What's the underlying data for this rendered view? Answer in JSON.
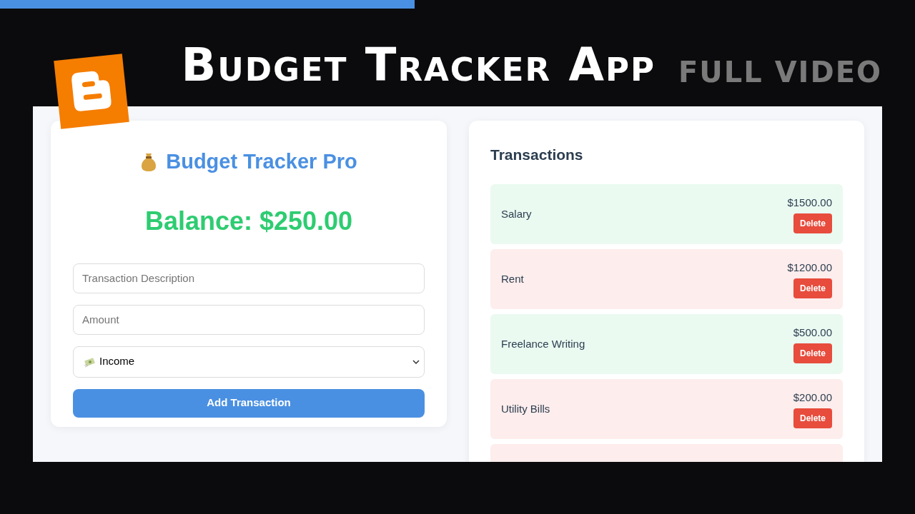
{
  "video_progress": {
    "level": 0.453
  },
  "headline": {
    "title": "Budget Tracker App",
    "tag": "FULL VIDEO"
  },
  "app": {
    "title": "Budget Tracker Pro",
    "balance": "Balance: $250.00",
    "form": {
      "description": {
        "placeholder": "Transaction Description"
      },
      "amount": {
        "placeholder": "Amount"
      },
      "type_select": {
        "value": "Income"
      },
      "submit": "Add Transaction"
    },
    "transactions": {
      "title": "Transactions",
      "items": [
        {
          "kind": "income",
          "description": "Salary",
          "amount": "$1500.00",
          "action": "Delete"
        },
        {
          "kind": "expense",
          "description": "Rent",
          "amount": "$1200.00",
          "action": "Delete"
        },
        {
          "kind": "income",
          "description": "Freelance Writing",
          "amount": "$500.00",
          "action": "Delete"
        },
        {
          "kind": "expense",
          "description": "Utility Bills",
          "amount": "$200.00",
          "action": "Delete"
        },
        {
          "kind": "expense"
        }
      ]
    }
  }
}
